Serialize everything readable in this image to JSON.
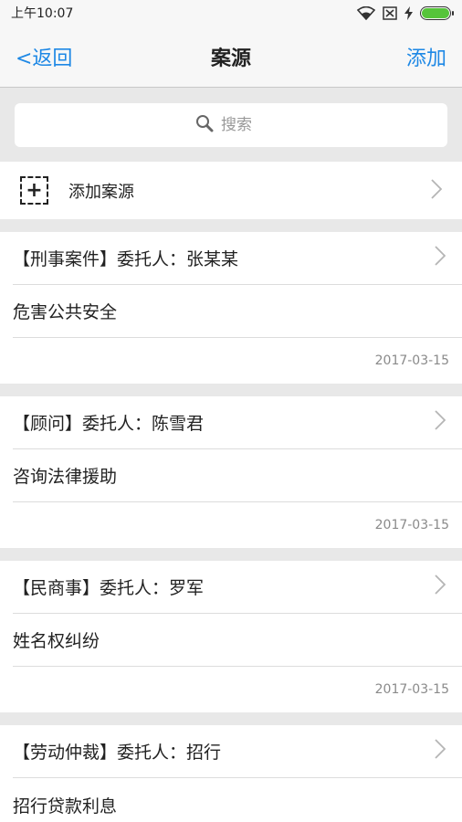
{
  "status_bar": {
    "time": "上午10:07"
  },
  "nav": {
    "back_label": "<返回",
    "title": "案源",
    "add_label": "添加"
  },
  "search": {
    "placeholder": "搜索"
  },
  "add_case": {
    "label": "添加案源"
  },
  "cases": [
    {
      "type": "【刑事案件】",
      "client_prefix": "委托人：",
      "client": "张某某",
      "description": "危害公共安全",
      "date": "2017-03-15"
    },
    {
      "type": "【顾问】",
      "client_prefix": "委托人：",
      "client": "陈雪君",
      "description": "咨询法律援助",
      "date": "2017-03-15"
    },
    {
      "type": "【民商事】",
      "client_prefix": "委托人：",
      "client": "罗军",
      "description": "姓名权纠纷",
      "date": "2017-03-15"
    },
    {
      "type": "【劳动仲裁】",
      "client_prefix": "委托人：",
      "client": "招行",
      "description": "招行贷款利息",
      "date": ""
    }
  ],
  "colors": {
    "accent": "#1e88e5",
    "battery": "#56c43a"
  },
  "icons": {
    "wifi": "wifi-icon",
    "sim": "sim-card-x-icon",
    "charging": "charging-bolt-icon",
    "battery": "battery-icon",
    "search": "search-icon",
    "add": "add-box-icon",
    "chevron": "chevron-right-icon"
  }
}
